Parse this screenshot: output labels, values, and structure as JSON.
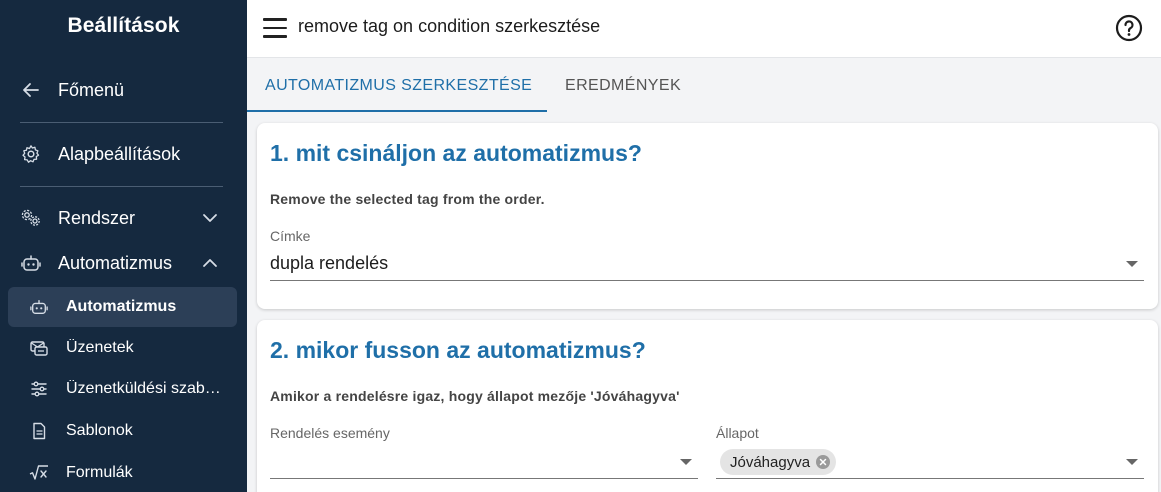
{
  "sidebar": {
    "title": "Beállítások",
    "back": {
      "label": "Főmenü",
      "icon": "arrow-left-icon"
    },
    "items": [
      {
        "label": "Alapbeállítások",
        "icon": "gear-icon"
      },
      {
        "label": "Rendszer",
        "icon": "gears-icon",
        "expanded": false
      },
      {
        "label": "Automatizmus",
        "icon": "robot-icon",
        "expanded": true
      }
    ],
    "subitems": [
      {
        "label": "Automatizmus",
        "icon": "robot-icon",
        "active": true
      },
      {
        "label": "Üzenetek",
        "icon": "messages-icon",
        "active": false
      },
      {
        "label": "Üzenetküldési szabályok",
        "icon": "sliders-icon",
        "active": false
      },
      {
        "label": "Sablonok",
        "icon": "document-icon",
        "active": false
      },
      {
        "label": "Formulák",
        "icon": "formula-icon",
        "active": false
      }
    ]
  },
  "header": {
    "title": "remove tag on condition szerkesztése",
    "help_icon": "help-circle-icon"
  },
  "tabs": [
    {
      "label": "AUTOMATIZMUS SZERKESZTÉSE",
      "active": true
    },
    {
      "label": "EREDMÉNYEK",
      "active": false
    }
  ],
  "section1": {
    "title": "1. mit csináljon az automatizmus?",
    "description": "Remove the selected tag from the order.",
    "field_label": "Címke",
    "field_value": "dupla rendelés"
  },
  "section2": {
    "title": "2. mikor fusson az automatizmus?",
    "description": "Amikor a rendelésre igaz, hogy állapot mezője 'Jóváhagyva'",
    "event_label": "Rendelés esemény",
    "event_value": "",
    "status_label": "Állapot",
    "status_chip": "Jóváhagyva"
  },
  "colors": {
    "sidebar_bg": "#15293f",
    "accent": "#1f6fa8"
  }
}
